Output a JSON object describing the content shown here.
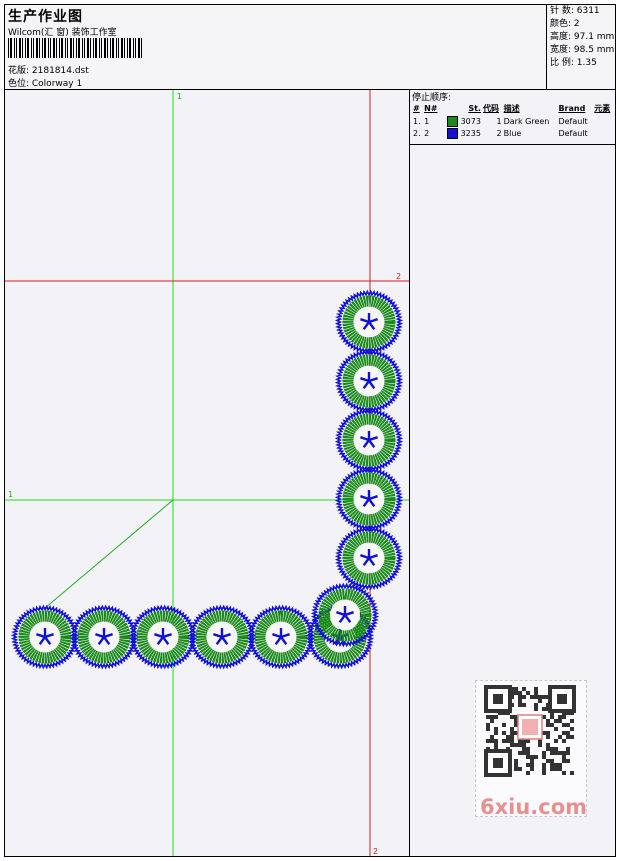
{
  "header": {
    "title": "生产作业图",
    "company": "Wilcom(汇 窗) 装饰工作室",
    "pattern_line": "花版: 2181814.dst",
    "colorway_line": "色位: Colorway 1"
  },
  "stats": {
    "stitches": "针 数: 6311",
    "colors": "颜色: 2",
    "height": "高度: 97.1 mm",
    "width": "宽度: 98.5 mm",
    "scale": "比 例: 1.35"
  },
  "stop_sequence": {
    "title": "停止顺序:",
    "columns": [
      "#",
      "N#",
      "St.",
      "代码",
      "描述",
      "Brand",
      "元素"
    ],
    "rows": [
      {
        "num": "1.",
        "needle": "1",
        "color": "#1a8a1a",
        "stitches": "3073",
        "code": "1",
        "desc": "Dark Green",
        "brand": "Default"
      },
      {
        "num": "2.",
        "needle": "2",
        "color": "#1010d8",
        "stitches": "3235",
        "code": "2",
        "desc": "Blue",
        "brand": "Default"
      }
    ]
  },
  "guides": {
    "green_v_label": "1",
    "green_h_label": "1",
    "red_h_label": "2",
    "red_v_label": "2"
  },
  "watermark": "6xiu.com"
}
